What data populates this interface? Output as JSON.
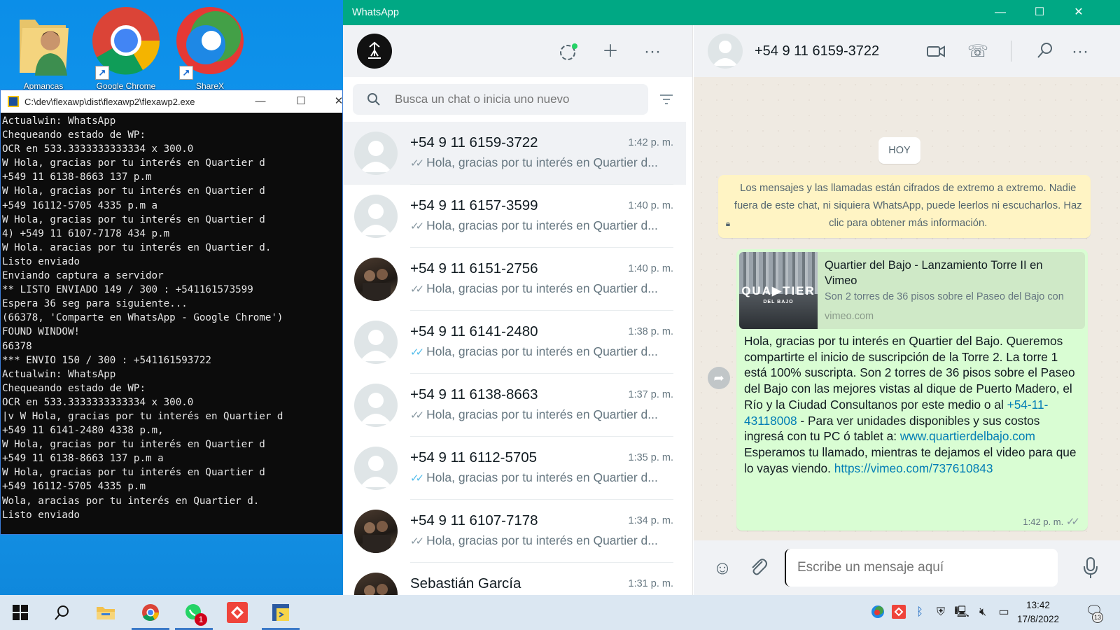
{
  "desktop": {
    "icons": [
      {
        "label": "Apmancas",
        "icon": "folder-user-icon"
      },
      {
        "label": "Google Chrome",
        "icon": "chrome-icon"
      },
      {
        "label": "ShareX",
        "icon": "sharex-icon"
      }
    ]
  },
  "console": {
    "title": "C:\\dev\\flexawp\\dist\\flexawp2\\flexawp2.exe",
    "lines": [
      "Actualwin: WhatsApp",
      "Chequeando estado de WP:",
      "OCR en 533.3333333333334 x 300.0",
      "W Hola, gracias por tu interés en Quartier d",
      "+549 11 6138-8663 137 p.m",
      "W Hola, gracias por tu interés en Quartier d",
      "+549 16112-5705 4335 p.m a",
      "W Hola, gracias por tu interés en Quartier d",
      "4) +549 11 6107-7178 434 p.m",
      "W Hola. aracias por tu interés en Quartier d.",
      "Listo enviado",
      "Enviando captura a servidor",
      "** LISTO ENVIADO 149 / 300 : +541161573599",
      "Espera 36 seg para siguiente...",
      "(66378, 'Comparte en WhatsApp - Google Chrome')",
      "FOUND WINDOW!",
      "66378",
      "*** ENVIO 150 / 300 : +541161593722",
      "Actualwin: WhatsApp",
      "Chequeando estado de WP:",
      "OCR en 533.3333333333334 x 300.0",
      "|v W Hola, gracias por tu interés en Quartier d",
      "+549 11 6141-2480 4338 p.m,",
      "W Hola, gracias por tu interés en Quartier d",
      "+549 11 6138-8663 137 p.m a",
      "W Hola, gracias por tu interés en Quartier d",
      "+549 16112-5705 4335 p.m",
      "Wola, aracias por tu interés en Quartier d.",
      "Listo enviado"
    ]
  },
  "whatsapp": {
    "window_title": "WhatsApp",
    "search_placeholder": "Busca un chat o inicia uno nuevo",
    "chats": [
      {
        "name": "+54 9 11 6159-3722",
        "time": "1:42 p. m.",
        "preview": "Hola, gracias por tu interés en Quartier d...",
        "read": false,
        "selected": true,
        "avatar": "default"
      },
      {
        "name": "+54 9 11 6157-3599",
        "time": "1:40 p. m.",
        "preview": "Hola, gracias por tu interés en Quartier d...",
        "read": false,
        "selected": false,
        "avatar": "default"
      },
      {
        "name": "+54 9 11 6151-2756",
        "time": "1:40 p. m.",
        "preview": "Hola, gracias por tu interés en Quartier d...",
        "read": false,
        "selected": false,
        "avatar": "photo"
      },
      {
        "name": "+54 9 11 6141-2480",
        "time": "1:38 p. m.",
        "preview": "Hola, gracias por tu interés en Quartier d...",
        "read": true,
        "selected": false,
        "avatar": "default"
      },
      {
        "name": "+54 9 11 6138-8663",
        "time": "1:37 p. m.",
        "preview": "Hola, gracias por tu interés en Quartier d...",
        "read": false,
        "selected": false,
        "avatar": "default"
      },
      {
        "name": "+54 9 11 6112-5705",
        "time": "1:35 p. m.",
        "preview": "Hola, gracias por tu interés en Quartier d...",
        "read": true,
        "selected": false,
        "avatar": "default"
      },
      {
        "name": "+54 9 11 6107-7178",
        "time": "1:34 p. m.",
        "preview": "Hola, gracias por tu interés en Quartier d...",
        "read": false,
        "selected": false,
        "avatar": "photo"
      },
      {
        "name": "Sebastián García",
        "time": "1:31 p. m.",
        "preview": "",
        "read": false,
        "selected": false,
        "avatar": "photo"
      }
    ],
    "conversation": {
      "contact": "+54 9 11 6159-3722",
      "date_chip": "HOY",
      "encryption_notice": "Los mensajes y las llamadas están cifrados de extremo a extremo. Nadie fuera de este chat, ni siquiera WhatsApp, puede leerlos ni escucharlos. Haz clic para obtener más información.",
      "link_preview": {
        "title": "Quartier del Bajo - Lanzamiento Torre II en Vimeo",
        "description": "Son 2 torres de 36 pisos sobre el Paseo del Bajo con",
        "domain": "vimeo.com",
        "thumb_text": "QUA▶TIER",
        "thumb_subtext": "DEL BAJO"
      },
      "message": {
        "part1": "Hola, gracias por tu interés en Quartier del Bajo. Queremos compartirte el inicio de suscripción de la Torre 2. La torre 1 está 100% suscripta. Son 2 torres de 36 pisos sobre el Paseo del Bajo con las mejores vistas al dique de Puerto Madero, el Río y la Ciudad Consultanos por este medio o al ",
        "phone": "+54-11-43118008",
        "part2": " - Para ver unidades disponibles y sus costos ingresá con tu PC ó tablet a: ",
        "site": "www.quartierdelbajo.com",
        "part3": " Esperamos tu llamado, mientras te dejamos el video para que lo vayas viendo. ",
        "video": "https://vimeo.com/737610843",
        "time": "1:42 p. m."
      },
      "compose_placeholder": "Escribe un mensaje aquí"
    }
  },
  "taskbar": {
    "badge": "1",
    "clock_time": "13:42",
    "clock_date": "17/8/2022",
    "notif_count": "13"
  },
  "colors": {
    "accent": "#00a884",
    "bubble": "#d9fdd3",
    "notice": "#fff4c4",
    "link": "#027eb5",
    "read_tick": "#53bdeb"
  }
}
